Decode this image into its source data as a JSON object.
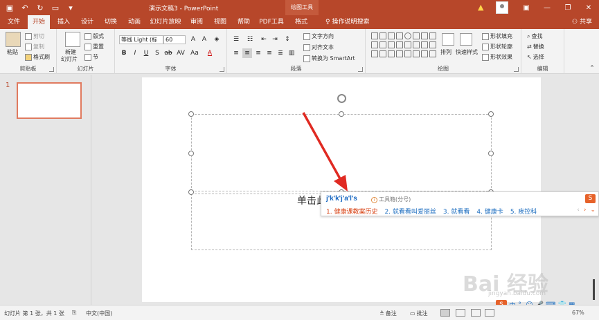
{
  "window": {
    "title": "演示文稿3 - PowerPoint",
    "context_tab_group": "绘图工具",
    "qat": [
      "save-icon",
      "undo-icon",
      "redo-icon",
      "present-icon",
      "customize-icon"
    ]
  },
  "tabs": [
    "文件",
    "开始",
    "插入",
    "设计",
    "切换",
    "动画",
    "幻灯片放映",
    "审阅",
    "视图",
    "帮助",
    "PDF工具",
    "格式"
  ],
  "active_tab": "开始",
  "tell_me": "操作说明搜索",
  "share": "共享",
  "ribbon": {
    "clipboard": {
      "label": "剪贴板",
      "paste": "粘贴",
      "cut": "剪切",
      "copy": "复制",
      "format_painter": "格式刷"
    },
    "slides": {
      "label": "幻灯片",
      "new_slide": "新建",
      "new_slide2": "幻灯片",
      "layout": "版式",
      "reset": "重置",
      "section": "节"
    },
    "font": {
      "label": "字体",
      "font_name": "等线 Light (标",
      "font_size": "60"
    },
    "paragraph": {
      "label": "段落",
      "text_direction": "文字方向",
      "align_text": "对齐文本",
      "convert_smartart": "转换为 SmartArt"
    },
    "drawing": {
      "label": "绘图",
      "arrange": "排列",
      "quick_styles": "快速样式",
      "shape_fill": "形状填充",
      "shape_outline": "形状轮廓",
      "shape_effects": "形状效果"
    },
    "editing": {
      "label": "编辑",
      "find": "查找",
      "replace": "替换",
      "select": "选择"
    }
  },
  "slide_pane": {
    "slide_number": "1"
  },
  "canvas": {
    "subtitle_placeholder": "单击此"
  },
  "ime": {
    "input": "j'k'k'j'a'l's",
    "hint": "工具箱(分号)",
    "candidates": [
      "1. 健康课教案历史",
      "2. 就看看叫爱丽丝",
      "3. 就看看",
      "4. 健康卡",
      "5. 疾控科"
    ],
    "logo": "S"
  },
  "status": {
    "slide_info": "幻灯片 第 1 张，共 1 张",
    "language": "中文(中国)",
    "notes": "备注",
    "comments": "批注",
    "zoom": "67%"
  },
  "tray": [
    "中",
    "°,",
    "☺",
    "🎤",
    "⌨",
    "👕",
    "▦"
  ],
  "watermark": {
    "main": "Bai 经验",
    "sub": "jingyan.baidu.com"
  }
}
